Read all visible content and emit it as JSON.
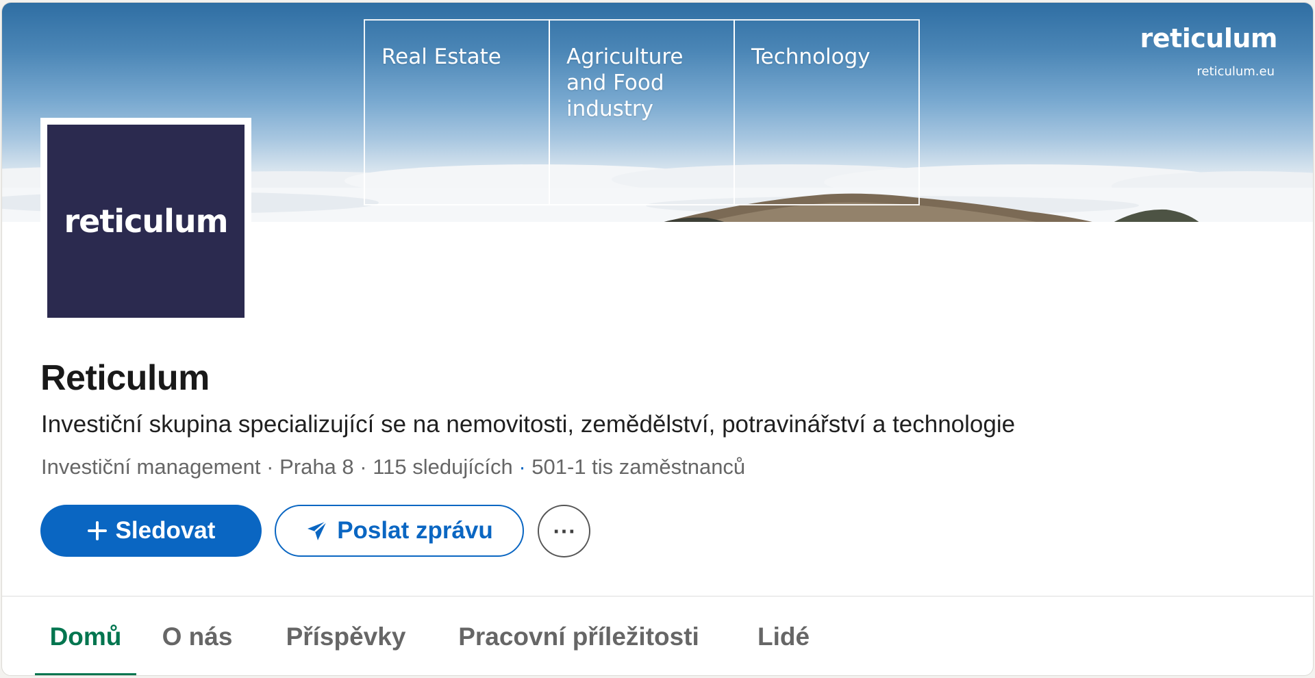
{
  "banner": {
    "sectors": [
      "Real Estate",
      "Agriculture and Food industry",
      "Technology"
    ],
    "brand": "reticulum",
    "url": "reticulum.eu"
  },
  "logo": {
    "text": "reticulum"
  },
  "company": {
    "name": "Reticulum",
    "tagline": "Investiční skupina specializující se na nemovitosti, zemědělství, potravinářství a technologie",
    "industry": "Investiční management",
    "location": "Praha 8",
    "followers": "115 sledujících",
    "employees": "501-1 tis zaměstnanců"
  },
  "actions": {
    "follow_label": "Sledovat",
    "message_label": "Poslat zprávu",
    "more_label": "⋯"
  },
  "tabs": [
    {
      "label": "Domů",
      "active": true
    },
    {
      "label": "O nás",
      "active": false
    },
    {
      "label": "Příspěvky",
      "active": false
    },
    {
      "label": "Pracovní příležitosti",
      "active": false
    },
    {
      "label": "Lidé",
      "active": false
    }
  ],
  "colors": {
    "primary": "#0a66c2",
    "active_tab": "#01754f",
    "logo_bg": "#2b2a4f"
  }
}
